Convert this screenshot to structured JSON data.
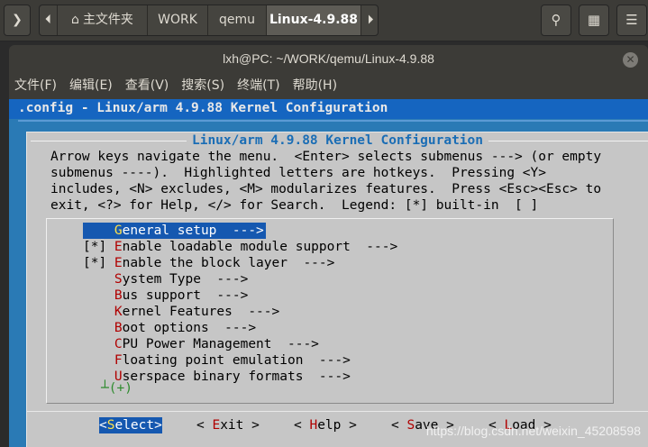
{
  "file_manager": {
    "breadcrumbs": [
      "主文件夹",
      "WORK",
      "qemu",
      "Linux-4.9.88"
    ],
    "active_crumb": "Linux-4.9.88"
  },
  "terminal": {
    "title": "lxh@PC: ~/WORK/qemu/Linux-4.9.88",
    "menu": [
      "文件(F)",
      "编辑(E)",
      "查看(V)",
      "搜索(S)",
      "终端(T)",
      "帮助(H)"
    ]
  },
  "menuconfig": {
    "backtitle": ".config - Linux/arm 4.9.88 Kernel Configuration",
    "dialog_title": "Linux/arm 4.9.88 Kernel Configuration",
    "help_lines": [
      "Arrow keys navigate the menu.  <Enter> selects submenus ---> (or empty",
      "submenus ----).  Highlighted letters are hotkeys.  Pressing <Y>",
      "includes, <N> excludes, <M> modularizes features.  Press <Esc><Esc> to",
      "exit, <?> for Help, </> for Search.  Legend: [*] built-in  [ ]"
    ],
    "items": [
      {
        "prefix": "    ",
        "hot": "G",
        "rest": "eneral setup  --->",
        "selected": true
      },
      {
        "prefix": "[*] ",
        "hot": "E",
        "rest": "nable loadable module support  --->",
        "selected": false
      },
      {
        "prefix": "[*] ",
        "hot": "E",
        "rest": "nable the block layer  --->",
        "selected": false
      },
      {
        "prefix": "    ",
        "hot": "S",
        "rest": "ystem Type  --->",
        "selected": false
      },
      {
        "prefix": "    ",
        "hot": "B",
        "rest": "us support  --->",
        "selected": false
      },
      {
        "prefix": "    ",
        "hot": "K",
        "rest": "ernel Features  --->",
        "selected": false
      },
      {
        "prefix": "    ",
        "hot": "B",
        "rest": "oot options  --->",
        "selected": false
      },
      {
        "prefix": "    ",
        "hot": "C",
        "rest": "PU Power Management  --->",
        "selected": false
      },
      {
        "prefix": "    ",
        "hot": "F",
        "rest": "loating point emulation  --->",
        "selected": false
      },
      {
        "prefix": "    ",
        "hot": "U",
        "rest": "serspace binary formats  --->",
        "selected": false
      }
    ],
    "more_indicator": "┴(+)",
    "buttons": [
      {
        "pre": "<",
        "hot": "S",
        "post": "elect>",
        "selected": true
      },
      {
        "pre": "< ",
        "hot": "E",
        "post": "xit >",
        "selected": false
      },
      {
        "pre": "< ",
        "hot": "H",
        "post": "elp >",
        "selected": false
      },
      {
        "pre": "< ",
        "hot": "S",
        "post": "ave >",
        "selected": false
      },
      {
        "pre": "< ",
        "hot": "L",
        "post": "oad >",
        "selected": false
      }
    ]
  },
  "watermark": "https://blog.csdn.net/weixin_45208598"
}
